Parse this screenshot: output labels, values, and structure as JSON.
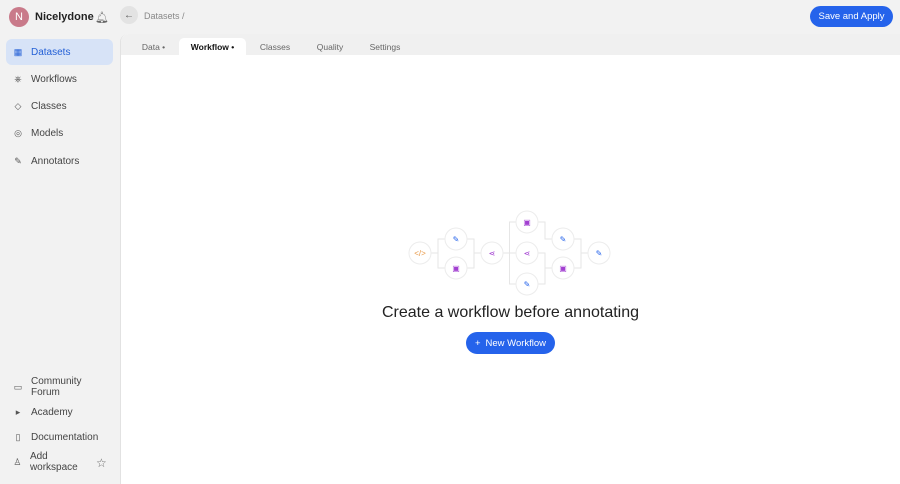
{
  "workspace": {
    "initial": "N",
    "name": "Nicelydone"
  },
  "sidebar": {
    "items": [
      {
        "label": "Datasets",
        "icon": "datasets-icon",
        "glyph": "▦",
        "active": true
      },
      {
        "label": "Workflows",
        "icon": "workflows-icon",
        "glyph": "⎈"
      },
      {
        "label": "Classes",
        "icon": "tag-icon",
        "glyph": "◇"
      },
      {
        "label": "Models",
        "icon": "models-icon",
        "glyph": "◎"
      },
      {
        "label": "Annotators",
        "icon": "pen-icon",
        "glyph": "✎"
      }
    ],
    "bottom": [
      {
        "label": "Community Forum",
        "icon": "chat-icon",
        "glyph": "▭"
      },
      {
        "label": "Academy",
        "icon": "play-icon",
        "glyph": "▸"
      },
      {
        "label": "Documentation",
        "icon": "document-icon",
        "glyph": "▯"
      },
      {
        "label": "Add workspace",
        "icon": "user-add-icon",
        "glyph": "♙"
      }
    ]
  },
  "header": {
    "breadcrumb": "Datasets /",
    "save_label": "Save and Apply"
  },
  "tabs": [
    "Data •",
    "Workflow •",
    "Classes",
    "Quality",
    "Settings"
  ],
  "empty": {
    "title": "Create a workflow before annotating",
    "button": "New Workflow",
    "button_icon": "+"
  },
  "colors": {
    "accent": "#2563eb",
    "purple": "#a23fd1",
    "orange": "#e89a4a"
  }
}
